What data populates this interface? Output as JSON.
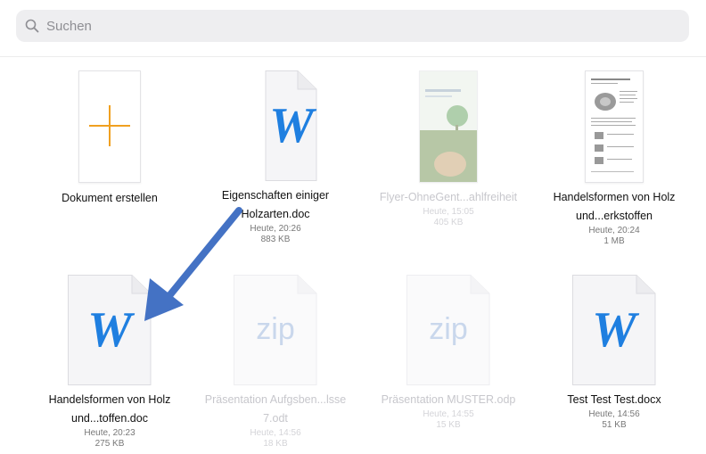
{
  "search": {
    "placeholder": "Suchen"
  },
  "files": [
    {
      "name": "Dokument erstellen",
      "date": "",
      "size": ""
    },
    {
      "name": "Eigenschaften einiger Holzarten.doc",
      "date": "Heute, 20:26",
      "size": "883 KB"
    },
    {
      "name": "Flyer-OhneGent...ahlfreiheit",
      "date": "Heute, 15:05",
      "size": "405 KB"
    },
    {
      "name": "Handelsformen von Holz und...erkstoffen",
      "date": "Heute, 20:24",
      "size": "1 MB"
    },
    {
      "name": "Handelsformen von Holz und...toffen.doc",
      "date": "Heute, 20:23",
      "size": "275 KB"
    },
    {
      "name": "Präsentation Aufgsben...lsse 7.odt",
      "date": "Heute, 14:56",
      "size": "18 KB"
    },
    {
      "name": "Präsentation MUSTER.odp",
      "date": "Heute, 14:55",
      "size": "15 KB"
    },
    {
      "name": "Test Test Test.docx",
      "date": "Heute, 14:56",
      "size": "51 KB"
    }
  ],
  "icons": {
    "word_letter": "W",
    "zip_label": "zip",
    "plus": "+"
  },
  "colors": {
    "accent_orange": "#f0a020",
    "word_blue": "#1f7fe0",
    "arrow_blue": "#4472c4"
  }
}
